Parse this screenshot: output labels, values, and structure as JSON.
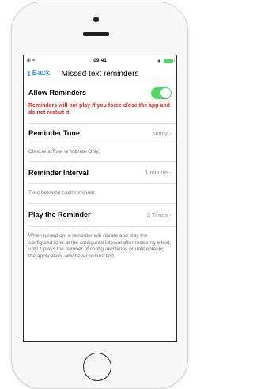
{
  "status_bar": {
    "time": "09:41",
    "signal": "ıll",
    "wifi": "≈",
    "bluetooth": "∗"
  },
  "nav": {
    "back_label": "Back",
    "title": "Missed text reminders"
  },
  "allow": {
    "label": "Allow Reminders",
    "enabled": true,
    "warning": "Reminders will not play if you force close the app and do not restart it."
  },
  "tone": {
    "label": "Reminder Tone",
    "value": "Notify",
    "description": "Choose a Tone or Vibrate Only."
  },
  "interval": {
    "label": "Reminder Interval",
    "value": "1 minute",
    "description": "Time between each reminder."
  },
  "play": {
    "label": "Play the Reminder",
    "value": "3 Times",
    "description": "When turned on, a reminder will vibrate and play the configured tone at the configured interval after receiving a text, until it plays the number of configured times or until entering the application, whichever occurs first."
  },
  "colors": {
    "accent": "#007aff",
    "toggle_on": "#4cd964",
    "warning": "#e0251b"
  }
}
